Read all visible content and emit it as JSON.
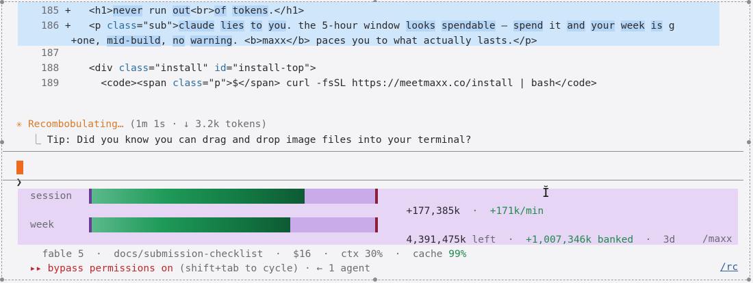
{
  "code_lines": [
    {
      "num": "185",
      "sign": "+",
      "parts": [
        [
          "plain",
          "  <h1>"
        ],
        [
          "hl",
          "never"
        ],
        [
          "plain",
          " run "
        ],
        [
          "hl",
          "out"
        ],
        [
          "plain",
          "<br>"
        ],
        [
          "hl",
          "of"
        ],
        [
          "plain",
          " "
        ],
        [
          "hl",
          "tokens"
        ],
        [
          "plain",
          ".</h1>"
        ]
      ]
    },
    {
      "num": "186",
      "sign": "+",
      "parts": [
        [
          "plain",
          "  <p "
        ],
        [
          "cls",
          "class"
        ],
        [
          "plain",
          "=\"sub\">"
        ],
        [
          "hl",
          "claude"
        ],
        [
          "plain",
          " "
        ],
        [
          "hl",
          "lies"
        ],
        [
          "plain",
          " "
        ],
        [
          "hl",
          "to"
        ],
        [
          "plain",
          " "
        ],
        [
          "hl",
          "you"
        ],
        [
          "plain",
          ". the 5-hour window "
        ],
        [
          "hl",
          "looks"
        ],
        [
          "plain",
          " "
        ],
        [
          "hl",
          "spendable"
        ],
        [
          "plain",
          " — "
        ],
        [
          "hl",
          "spend"
        ],
        [
          "plain",
          " it "
        ],
        [
          "hl",
          "and"
        ],
        [
          "plain",
          " "
        ],
        [
          "hl",
          "your"
        ],
        [
          "plain",
          " "
        ],
        [
          "hl",
          "week"
        ],
        [
          "plain",
          " "
        ],
        [
          "hl",
          "is"
        ],
        [
          "plain",
          " g"
        ]
      ]
    },
    {
      "num": "",
      "sign": "+",
      "parts": [
        [
          "plain",
          "one, "
        ],
        [
          "hl",
          "mid-build"
        ],
        [
          "plain",
          ", "
        ],
        [
          "hl",
          "no"
        ],
        [
          "plain",
          " "
        ],
        [
          "hl",
          "warning"
        ],
        [
          "plain",
          ". <b>maxx</b> paces you to what actually lasts.</p>"
        ]
      ]
    },
    {
      "num": "187",
      "sign": "",
      "parts": []
    },
    {
      "num": "188",
      "sign": "",
      "parts": [
        [
          "plain",
          "  <div "
        ],
        [
          "cls",
          "class"
        ],
        [
          "plain",
          "=\"install\" "
        ],
        [
          "cls",
          "id"
        ],
        [
          "plain",
          "=\"install-top\">"
        ]
      ]
    },
    {
      "num": "189",
      "sign": "",
      "parts": [
        [
          "plain",
          "    <code><span "
        ],
        [
          "cls",
          "class"
        ],
        [
          "plain",
          "=\"p\">$</span> curl -fsSL https://meetmaxx.co/install | bash</code>"
        ]
      ]
    }
  ],
  "spinner": {
    "glyph": "✳",
    "label": "Recombobulating…",
    "meta": " (1m 1s · ↓ 3.2k tokens)"
  },
  "tip": {
    "prefix": "⎿",
    "text": "Tip: Did you know you can drag and drop image files into your terminal?"
  },
  "prompt": {
    "glyph": "❯"
  },
  "session": {
    "label": "session",
    "fill_fraction": 0.75,
    "value": "+177,385k",
    "sep": "·",
    "rate": "+171k/min"
  },
  "week": {
    "label": "week",
    "fill_fraction": 0.7,
    "value": "4,391,475k",
    "left": "left",
    "sep1": "·",
    "banked": "+1,007,346k banked",
    "sep2": "·",
    "days": "3d"
  },
  "info": {
    "model": "fable 5",
    "sep": "·",
    "path": "docs/submission-checklist",
    "cost": "$16",
    "ctx": "ctx 30%",
    "cache_label": "cache",
    "cache_value": "99%",
    "command": "/maxx"
  },
  "bypass": {
    "arrows": "▸▸",
    "text": "bypass permissions on",
    "hint": " (shift+tab to cycle) · ← 1 agent"
  },
  "rc_link": "/rc",
  "colors": {
    "accent_orange": "#ef6a1e",
    "green_bar": "#1f8a4d",
    "status_bg": "#e6d5f5",
    "selection": "#cfe6fb"
  }
}
